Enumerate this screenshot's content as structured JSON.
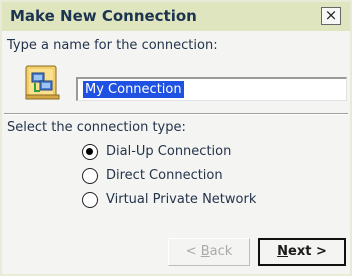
{
  "window": {
    "title": "Make New Connection",
    "close_symbol": "×"
  },
  "name_section": {
    "prompt": "Type a name for the connection:",
    "icon": "network-connection-icon",
    "input_value": "My Connection"
  },
  "type_section": {
    "label": "Select the connection type:",
    "options": [
      {
        "label": "Dial-Up Connection",
        "selected": true
      },
      {
        "label": "Direct Connection",
        "selected": false
      },
      {
        "label": "Virtual Private Network",
        "selected": false
      }
    ]
  },
  "buttons": {
    "back_prefix": "< ",
    "back_mnemonic": "B",
    "back_rest": "ack",
    "back_enabled": false,
    "next_mnemonic": "N",
    "next_rest": "ext >"
  },
  "colors": {
    "title_bar": "#dfe5bf",
    "title_text": "#1d3450",
    "selection": "#1f52e2",
    "background": "#f4f4f2"
  }
}
